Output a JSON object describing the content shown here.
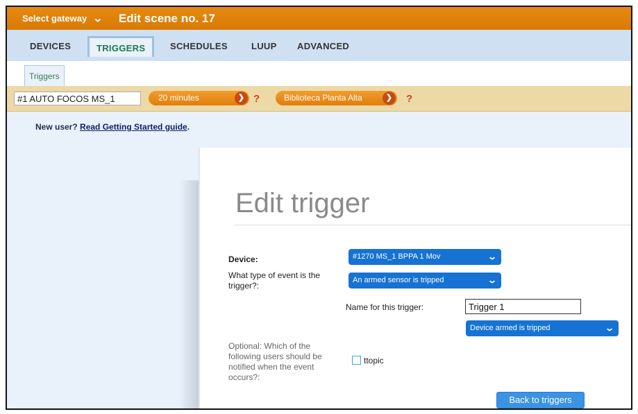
{
  "header": {
    "gateway_label": "Select gateway",
    "scene_title": "Edit scene no. 17"
  },
  "nav": {
    "tabs": [
      {
        "label": "DEVICES"
      },
      {
        "label": "TRIGGERS",
        "active": true
      },
      {
        "label": "SCHEDULES"
      },
      {
        "label": "LUUP"
      },
      {
        "label": "ADVANCED"
      }
    ]
  },
  "subtab": {
    "label": "Triggers"
  },
  "scenebar": {
    "scene_name": "#1 AUTO FOCOS MS_1",
    "delay": "20 minutes",
    "room": "Biblioteca Planta Alta",
    "help": "?"
  },
  "newuser": {
    "prefix": "New user?",
    "link": "Read Getting Started guide",
    "suffix": "."
  },
  "dialog": {
    "title": "Edit trigger",
    "device_label": "Device:",
    "device_value": "#1270 MS_1 BPPA 1 Mov",
    "event_label": "What type of event is the trigger?:",
    "event_value": "An armed sensor is tripped",
    "name_label": "Name for this trigger:",
    "name_value": "Trigger 1",
    "state_value": "Device armed is tripped",
    "notify_label": "Optional: Which of the following users should be notified when the event occurs?:",
    "user": "ttopic",
    "user_checked": false,
    "back_button": "Back to triggers"
  },
  "colors": {
    "header_orange": "#e08608",
    "select_blue": "#1673d4",
    "scenebar_tan": "#ecd9a6",
    "active_tab_green": "#1f7a4a"
  }
}
